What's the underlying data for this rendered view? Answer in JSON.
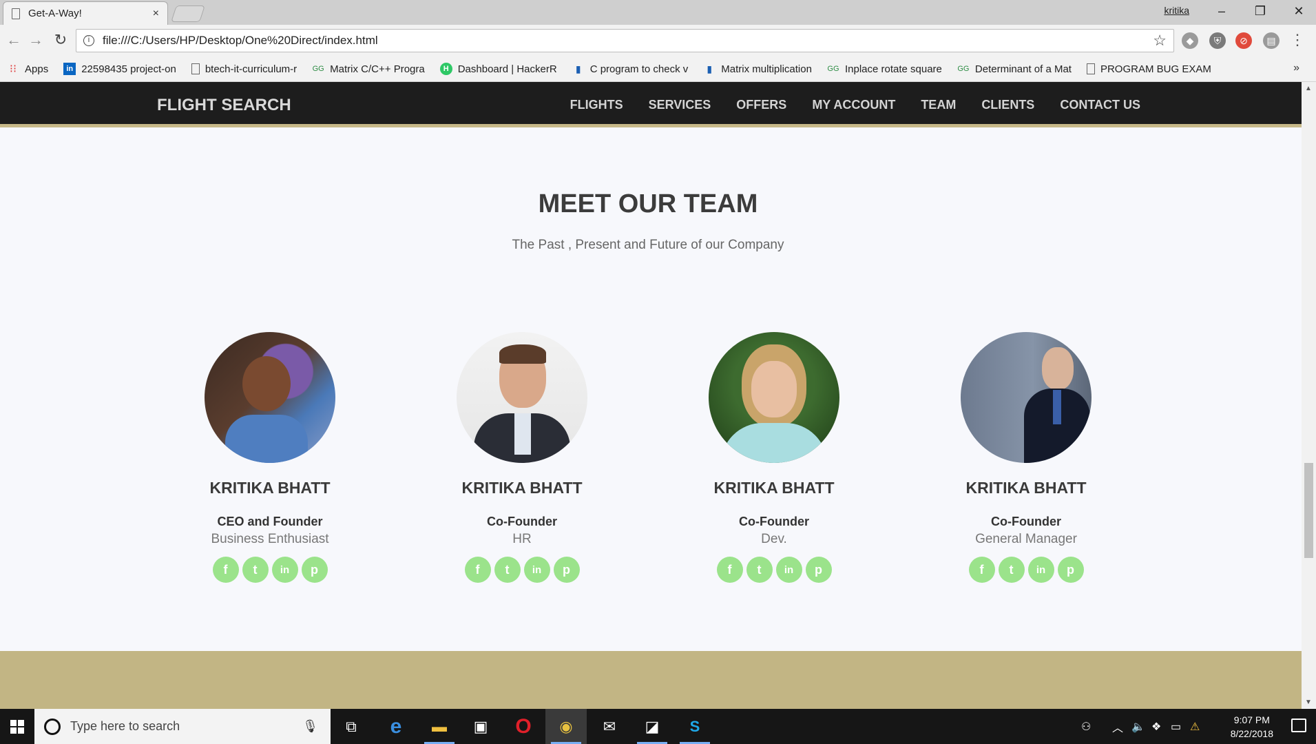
{
  "browser": {
    "tab_title": "Get-A-Way!",
    "tab_close": "×",
    "user_name": "kritika",
    "url": "file:///C:/Users/HP/Desktop/One%20Direct/index.html",
    "bookmarks": [
      {
        "label": "Apps",
        "icon": "apps-grid-icon"
      },
      {
        "label": "22598435 project-on",
        "icon": "linkedin-icon"
      },
      {
        "label": "btech-it-curriculum-r",
        "icon": "document-icon"
      },
      {
        "label": "Matrix C/C++ Progra",
        "icon": "geeksforgeeks-icon"
      },
      {
        "label": "Dashboard | HackerR",
        "icon": "hackerrank-icon"
      },
      {
        "label": "C program to check v",
        "icon": "bookmark-icon"
      },
      {
        "label": "Matrix multiplication",
        "icon": "bookmark-icon"
      },
      {
        "label": "Inplace rotate square",
        "icon": "geeksforgeeks-icon"
      },
      {
        "label": "Determinant of a Mat",
        "icon": "geeksforgeeks-icon"
      },
      {
        "label": "PROGRAM BUG EXAM",
        "icon": "document-icon"
      }
    ],
    "bookmarks_more": "»"
  },
  "site": {
    "brand": "FLIGHT SEARCH",
    "menu": [
      "FLIGHTS",
      "SERVICES",
      "OFFERS",
      "MY ACCOUNT",
      "TEAM",
      "CLIENTS",
      "CONTACT US"
    ]
  },
  "team": {
    "title": "MEET OUR TEAM",
    "subtitle": "The Past , Present and Future of our Company",
    "members": [
      {
        "name": "KRITIKA BHATT",
        "role": "CEO and Founder",
        "dept": "Business Enthusiast"
      },
      {
        "name": "KRITIKA BHATT",
        "role": "Co-Founder",
        "dept": "HR"
      },
      {
        "name": "KRITIKA BHATT",
        "role": "Co-Founder",
        "dept": "Dev."
      },
      {
        "name": "KRITIKA BHATT",
        "role": "Co-Founder",
        "dept": "General Manager"
      }
    ],
    "social_glyphs": {
      "facebook": "f",
      "twitter": "t",
      "linkedin": "in",
      "pinterest": "p"
    }
  },
  "taskbar": {
    "search_placeholder": "Type here to search",
    "time": "9:07 PM",
    "date": "8/22/2018"
  },
  "colors": {
    "nav_bg": "#1d1d1d",
    "accent_gold": "#c2b584",
    "social_green": "#9be38b"
  }
}
